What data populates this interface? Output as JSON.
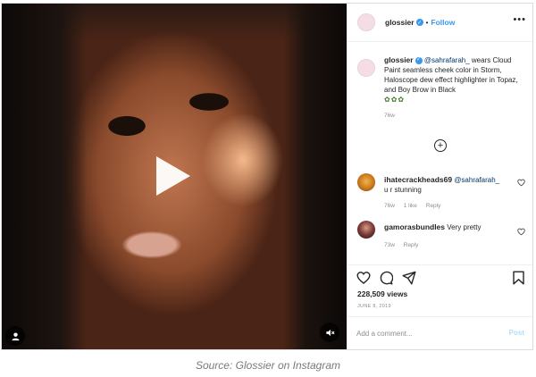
{
  "post": {
    "account": "glossier",
    "verified_mark": "✓",
    "separator": "•",
    "follow_label": "Follow",
    "more_label": "•••",
    "caption": {
      "username": "glossier",
      "mention": "@sahrafarah_",
      "text": " wears Cloud Paint seamless cheek color in Storm, Haloscope dew effect highlighter in Topaz, and Boy Brow in Black",
      "emoji": "✿✿✿",
      "time": "76w"
    },
    "load_more_label": "+",
    "comments": [
      {
        "username": "ihatecrackheads69",
        "mention": "@sahrafarah_",
        "text": "u r stunning",
        "time": "76w",
        "likes": "1 like",
        "reply": "Reply"
      },
      {
        "username": "gamorasbundles",
        "mention": "",
        "text": "Very pretty",
        "time": "73w",
        "likes": "",
        "reply": "Reply"
      }
    ],
    "likes_count": "228,509 views",
    "date": "JUNE 8, 2019",
    "add_comment_placeholder": "Add a comment...",
    "post_label": "Post",
    "icons": {
      "play": "play-icon",
      "user": "user-icon",
      "mute": "speaker-muted-icon",
      "like": "heart-icon",
      "comment": "comment-icon",
      "share": "send-icon",
      "save": "bookmark-icon",
      "options": "more-options-icon"
    },
    "colors": {
      "link": "#3897f0",
      "mention": "#00376b",
      "muted": "#8e8e8e"
    }
  },
  "source_caption": "Source: Glossier on Instagram"
}
